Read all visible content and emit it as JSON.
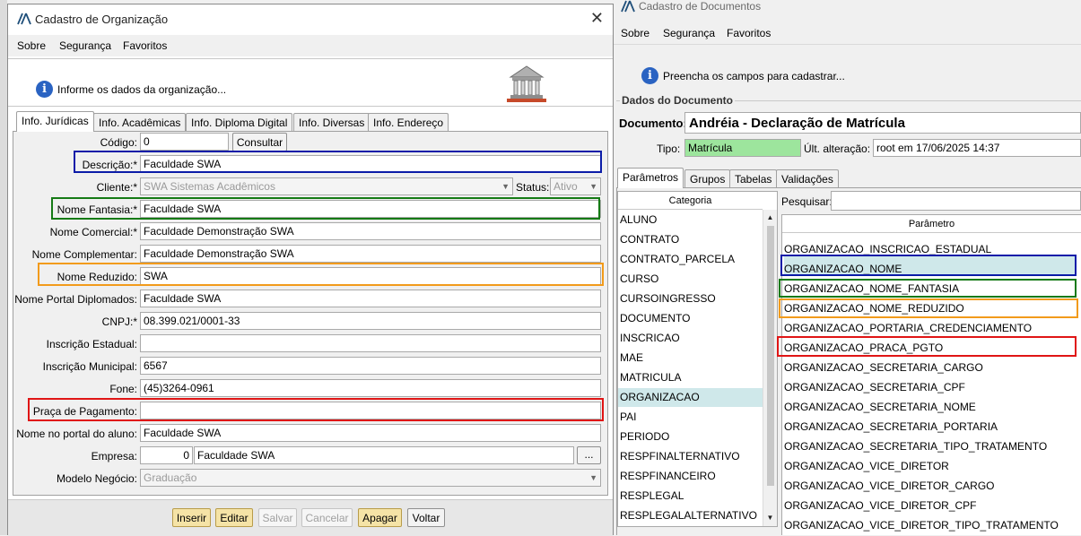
{
  "org_window": {
    "title": "Cadastro de Organização",
    "close_glyph": "✕",
    "menu": [
      "Sobre",
      "Segurança",
      "Favoritos"
    ],
    "info_text": "Informe os dados da organização...",
    "tabs": [
      "Info. Jurídicas",
      "Info. Acadêmicas",
      "Info. Diploma Digital",
      "Info. Diversas",
      "Info. Endereço"
    ],
    "active_tab": "Info. Jurídicas",
    "fields": {
      "codigo": {
        "label": "Código:",
        "value": "0"
      },
      "consultar_button": "Consultar",
      "descricao": {
        "label": "Descrição:*",
        "value": "Faculdade SWA"
      },
      "cliente": {
        "label": "Cliente:*",
        "value": "SWA Sistemas Acadêmicos"
      },
      "status": {
        "label": "Status:",
        "value": "Ativo"
      },
      "nome_fantasia": {
        "label": "Nome Fantasia:*",
        "value": "Faculdade SWA"
      },
      "nome_comercial": {
        "label": "Nome Comercial:*",
        "value": "Faculdade Demonstração SWA"
      },
      "nome_complementar": {
        "label": "Nome Complementar:",
        "value": "Faculdade Demonstração SWA"
      },
      "nome_reduzido": {
        "label": "Nome Reduzido:",
        "value": "SWA"
      },
      "nome_portal_diplomados": {
        "label": "Nome Portal Diplomados:",
        "value": "Faculdade SWA"
      },
      "cnpj": {
        "label": "CNPJ:*",
        "value": "08.399.021/0001-33"
      },
      "inscricao_estadual": {
        "label": "Inscrição Estadual:",
        "value": ""
      },
      "inscricao_municipal": {
        "label": "Inscrição Municipal:",
        "value": "6567"
      },
      "fone": {
        "label": "Fone:",
        "value": "(45)3264-0961"
      },
      "praca_pagamento": {
        "label": "Praça de Pagamento:",
        "value": ""
      },
      "nome_portal_aluno": {
        "label": "Nome no portal do aluno:",
        "value": "Faculdade SWA"
      },
      "empresa": {
        "label": "Empresa:",
        "code": "0",
        "value": "Faculdade SWA",
        "lookup": "..."
      },
      "modelo_negocio": {
        "label": "Modelo Negócio:",
        "value": "Graduação"
      }
    },
    "buttons": {
      "inserir": "Inserir",
      "editar": "Editar",
      "salvar": "Salvar",
      "cancelar": "Cancelar",
      "apagar": "Apagar",
      "voltar": "Voltar"
    }
  },
  "doc_window": {
    "title": "Cadastro de Documentos",
    "menu": [
      "Sobre",
      "Segurança",
      "Favoritos"
    ],
    "info_text": "Preencha os campos para cadastrar...",
    "group_title": "Dados do Documento",
    "documento_label": "Documento:",
    "documento_value": "Andréia - Declaração de Matrícula",
    "tipo_label": "Tipo:",
    "tipo_value": "Matrícula",
    "ult_alteracao_label": "Últ. alteração:",
    "ult_alteracao_value": "root em 17/06/2025 14:37",
    "tabs": [
      "Parâmetros",
      "Grupos",
      "Tabelas",
      "Validações"
    ],
    "active_tab": "Parâmetros",
    "categoria_header": "Categoria",
    "categorias": [
      "ALUNO",
      "CONTRATO",
      "CONTRATO_PARCELA",
      "CURSO",
      "CURSOINGRESSO",
      "DOCUMENTO",
      "INSCRICAO",
      "MAE",
      "MATRICULA",
      "ORGANIZACAO",
      "PAI",
      "PERIODO",
      "RESPFINALTERNATIVO",
      "RESPFINANCEIRO",
      "RESPLEGAL",
      "RESPLEGALALTERNATIVO"
    ],
    "selected_categoria": "ORGANIZACAO",
    "pesquisar_label": "Pesquisar:",
    "parametro_header": "Parâmetro",
    "parametros": [
      "ORGANIZACAO_INSCRICAO_ESTADUAL",
      "ORGANIZACAO_NOME",
      "ORGANIZACAO_NOME_FANTASIA",
      "ORGANIZACAO_NOME_REDUZIDO",
      "ORGANIZACAO_PORTARIA_CREDENCIAMENTO",
      "ORGANIZACAO_PRACA_PGTO",
      "ORGANIZACAO_SECRETARIA_CARGO",
      "ORGANIZACAO_SECRETARIA_CPF",
      "ORGANIZACAO_SECRETARIA_NOME",
      "ORGANIZACAO_SECRETARIA_PORTARIA",
      "ORGANIZACAO_SECRETARIA_TIPO_TRATAMENTO",
      "ORGANIZACAO_VICE_DIRETOR",
      "ORGANIZACAO_VICE_DIRETOR_CARGO",
      "ORGANIZACAO_VICE_DIRETOR_CPF",
      "ORGANIZACAO_VICE_DIRETOR_TIPO_TRATAMENTO"
    ],
    "selected_parametro": "ORGANIZACAO_NOME"
  },
  "colors": {
    "highlight_blue": "#0b1ca8",
    "highlight_green": "#157a15",
    "highlight_orange": "#f29b1b",
    "highlight_red": "#e01515",
    "tipo_green": "#9de59d",
    "selection": "#cfe8ea"
  }
}
